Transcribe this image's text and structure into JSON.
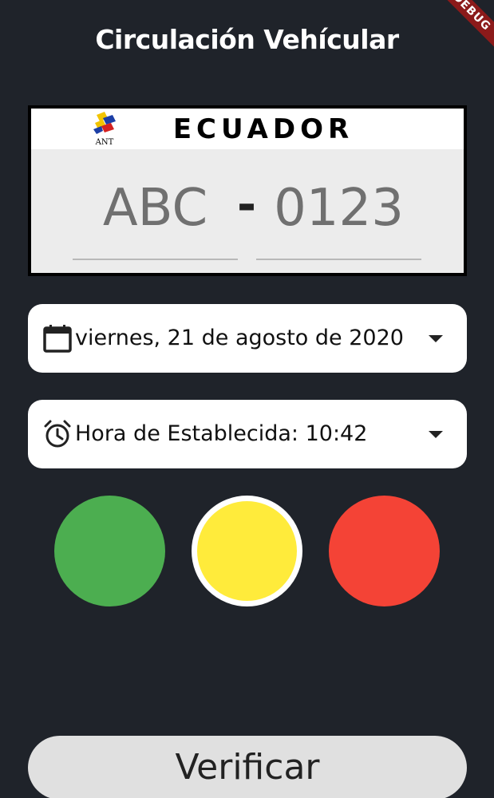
{
  "app": {
    "title": "Circulación Vehícular",
    "debug_banner": "DEBUG"
  },
  "plate": {
    "country": "ECUADOR",
    "logo_text": "ANT",
    "letters_placeholder": "ABC",
    "separator": "-",
    "numbers_placeholder": "0123"
  },
  "date_selector": {
    "value": "viernes, 21 de agosto de 2020",
    "icon": "calendar-icon"
  },
  "time_selector": {
    "value": "Hora de Establecida: 10:42",
    "icon": "alarm-clock-icon"
  },
  "traffic_light": {
    "green_color": "#4cae50",
    "yellow_color": "#ffeb3b",
    "red_color": "#f44336",
    "active": "yellow"
  },
  "verify_button": {
    "label": "Verificar"
  },
  "colors": {
    "background": "#1f232a",
    "card": "#ffffff",
    "button": "#e0e0e0"
  }
}
